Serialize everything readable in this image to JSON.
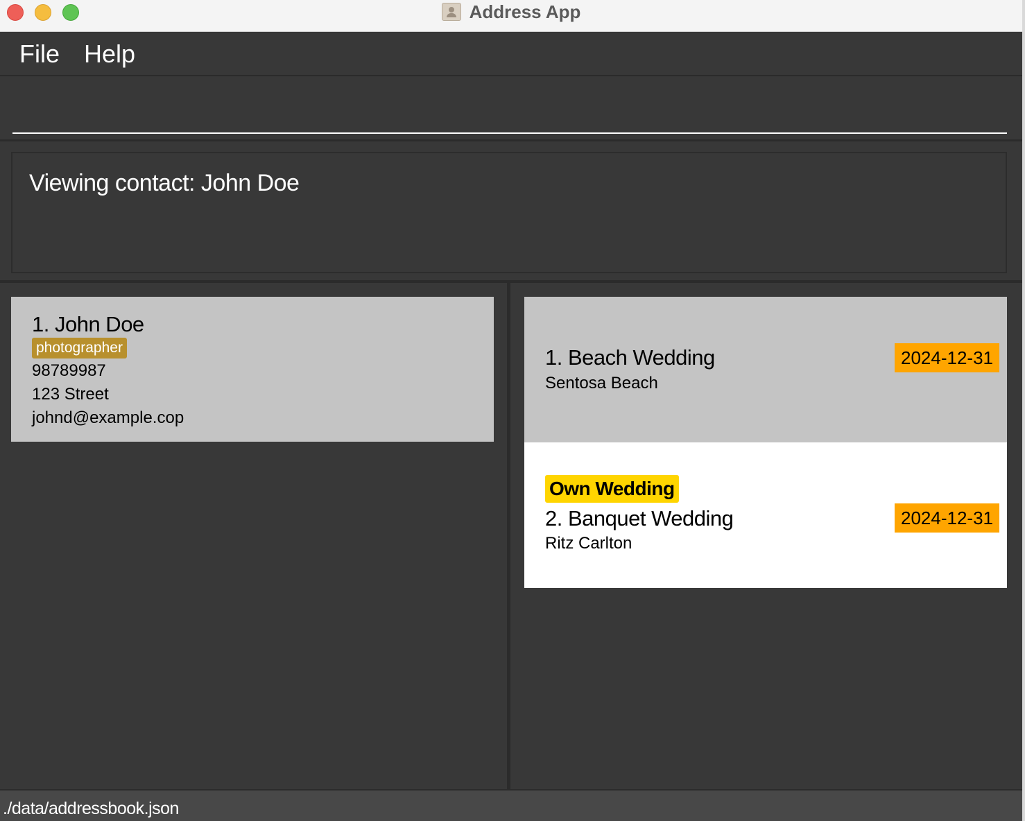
{
  "window": {
    "title": "Address App"
  },
  "menu": {
    "file": "File",
    "help": "Help"
  },
  "command": {
    "value": ""
  },
  "result": {
    "text": "Viewing contact: John Doe"
  },
  "person": {
    "name": "1. John Doe",
    "tag": "photographer",
    "phone": "98789987",
    "address": "123 Street",
    "email": "johnd@example.cop"
  },
  "weddings": [
    {
      "title": "1. Beach Wedding",
      "venue": "Sentosa Beach",
      "date": "2024-12-31"
    },
    {
      "tag": "Own Wedding",
      "title": "2. Banquet Wedding",
      "venue": "Ritz Carlton",
      "date": "2024-12-31"
    }
  ],
  "status": {
    "path": "./data/addressbook.json"
  },
  "colors": {
    "tag": "#b8902d",
    "date_badge": "#ffa500",
    "own_tag": "#ffd500"
  }
}
